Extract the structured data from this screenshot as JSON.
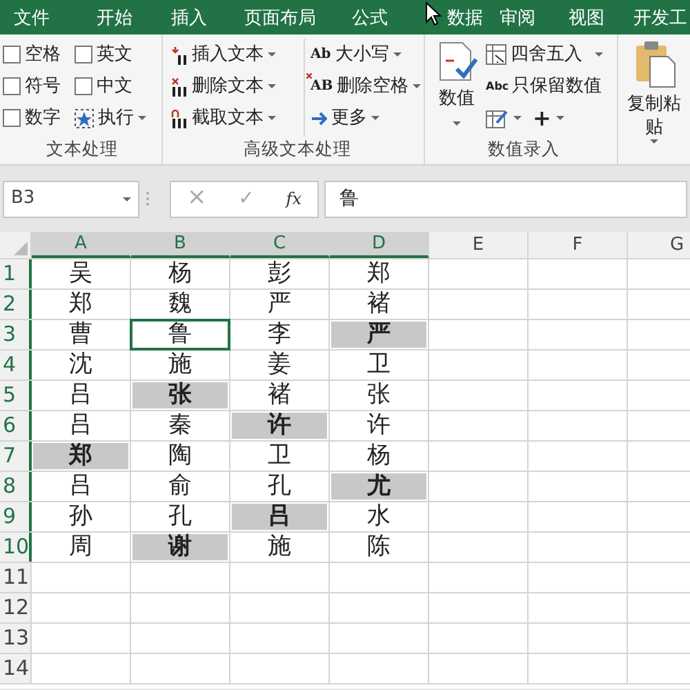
{
  "menu_tabs": [
    {
      "label": "文件"
    },
    {
      "label": "开始"
    },
    {
      "label": "插入"
    },
    {
      "label": "页面布局"
    },
    {
      "label": "公式"
    },
    {
      "label": "数据"
    },
    {
      "label": "审阅"
    },
    {
      "label": "视图"
    },
    {
      "label": "开发工"
    }
  ],
  "ribbon": {
    "text_group": {
      "label": "文本处理",
      "checkboxes": [
        {
          "label": "空格",
          "checked": false
        },
        {
          "label": "符号",
          "checked": false
        },
        {
          "label": "数字",
          "checked": false
        },
        {
          "label": "英文",
          "checked": false
        },
        {
          "label": "中文",
          "checked": false
        }
      ],
      "execute": {
        "label": "执行",
        "dropdown": true
      }
    },
    "advanced_group": {
      "label": "高级文本处理",
      "buttons": [
        {
          "label": "插入文本",
          "dropdown": true
        },
        {
          "label": "删除文本",
          "dropdown": true
        },
        {
          "label": "截取文本",
          "dropdown": true
        },
        {
          "icon_text": "Ab",
          "label": "大小写",
          "dropdown": true
        },
        {
          "icon_text": "AB",
          "label": "删除空格",
          "dropdown": true
        },
        {
          "label": "更多",
          "dropdown": true
        }
      ]
    },
    "number_group": {
      "label": "数值录入",
      "large_button": {
        "label": "数值",
        "dropdown": true
      },
      "buttons": [
        {
          "label": "四舍五入",
          "dropdown": true
        },
        {
          "icon_text": "Abc",
          "label": "只保留数值",
          "dropdown": false
        }
      ],
      "small_buttons": [
        {
          "dropdown": true
        },
        {
          "label": "+",
          "dropdown": true
        }
      ]
    },
    "paste_button": {
      "label": "复制粘贴",
      "dropdown": true
    }
  },
  "formula_bar": {
    "name_box": "B3",
    "cancel": "×",
    "enter": "✓",
    "function": "fx",
    "value": "鲁"
  },
  "columns": [
    {
      "label": "A",
      "selected": true
    },
    {
      "label": "B",
      "selected": true
    },
    {
      "label": "C",
      "selected": true
    },
    {
      "label": "D",
      "selected": true
    },
    {
      "label": "E",
      "selected": false
    },
    {
      "label": "F",
      "selected": false
    },
    {
      "label": "G",
      "selected": false
    }
  ],
  "rows": [
    {
      "label": "1",
      "selected": true,
      "cells": [
        {
          "text": "吴",
          "highlighted": false,
          "selected": false
        },
        {
          "text": "杨",
          "highlighted": false,
          "selected": false
        },
        {
          "text": "彭",
          "highlighted": false,
          "selected": false
        },
        {
          "text": "郑",
          "highlighted": false,
          "selected": false
        }
      ]
    },
    {
      "label": "2",
      "selected": true,
      "cells": [
        {
          "text": "郑",
          "highlighted": false,
          "selected": false
        },
        {
          "text": "魏",
          "highlighted": false,
          "selected": false
        },
        {
          "text": "严",
          "highlighted": false,
          "selected": false
        },
        {
          "text": "褚",
          "highlighted": false,
          "selected": false
        }
      ]
    },
    {
      "label": "3",
      "selected": true,
      "cells": [
        {
          "text": "曹",
          "highlighted": false,
          "selected": false
        },
        {
          "text": "鲁",
          "highlighted": false,
          "selected": true
        },
        {
          "text": "李",
          "highlighted": false,
          "selected": false
        },
        {
          "text": "严",
          "highlighted": true,
          "selected": false
        }
      ]
    },
    {
      "label": "4",
      "selected": true,
      "cells": [
        {
          "text": "沈",
          "highlighted": false,
          "selected": false
        },
        {
          "text": "施",
          "highlighted": false,
          "selected": false
        },
        {
          "text": "姜",
          "highlighted": false,
          "selected": false
        },
        {
          "text": "卫",
          "highlighted": false,
          "selected": false
        }
      ]
    },
    {
      "label": "5",
      "selected": true,
      "cells": [
        {
          "text": "吕",
          "highlighted": false,
          "selected": false
        },
        {
          "text": "张",
          "highlighted": true,
          "selected": false
        },
        {
          "text": "褚",
          "highlighted": false,
          "selected": false
        },
        {
          "text": "张",
          "highlighted": false,
          "selected": false
        }
      ]
    },
    {
      "label": "6",
      "selected": true,
      "cells": [
        {
          "text": "吕",
          "highlighted": false,
          "selected": false
        },
        {
          "text": "秦",
          "highlighted": false,
          "selected": false
        },
        {
          "text": "许",
          "highlighted": true,
          "selected": false
        },
        {
          "text": "许",
          "highlighted": false,
          "selected": false
        }
      ]
    },
    {
      "label": "7",
      "selected": true,
      "cells": [
        {
          "text": "郑",
          "highlighted": true,
          "selected": false
        },
        {
          "text": "陶",
          "highlighted": false,
          "selected": false
        },
        {
          "text": "卫",
          "highlighted": false,
          "selected": false
        },
        {
          "text": "杨",
          "highlighted": false,
          "selected": false
        }
      ]
    },
    {
      "label": "8",
      "selected": true,
      "cells": [
        {
          "text": "吕",
          "highlighted": false,
          "selected": false
        },
        {
          "text": "俞",
          "highlighted": false,
          "selected": false
        },
        {
          "text": "孔",
          "highlighted": false,
          "selected": false
        },
        {
          "text": "尤",
          "highlighted": true,
          "selected": false
        }
      ]
    },
    {
      "label": "9",
      "selected": true,
      "cells": [
        {
          "text": "孙",
          "highlighted": false,
          "selected": false
        },
        {
          "text": "孔",
          "highlighted": false,
          "selected": false
        },
        {
          "text": "吕",
          "highlighted": true,
          "selected": false
        },
        {
          "text": "水",
          "highlighted": false,
          "selected": false
        }
      ]
    },
    {
      "label": "10",
      "selected": true,
      "cells": [
        {
          "text": "周",
          "highlighted": false,
          "selected": false
        },
        {
          "text": "谢",
          "highlighted": true,
          "selected": false
        },
        {
          "text": "施",
          "highlighted": false,
          "selected": false
        },
        {
          "text": "陈",
          "highlighted": false,
          "selected": false
        }
      ]
    },
    {
      "label": "11",
      "selected": false,
      "cells": []
    },
    {
      "label": "12",
      "selected": false,
      "cells": []
    },
    {
      "label": "13",
      "selected": false,
      "cells": []
    },
    {
      "label": "14",
      "selected": false,
      "cells": []
    }
  ]
}
